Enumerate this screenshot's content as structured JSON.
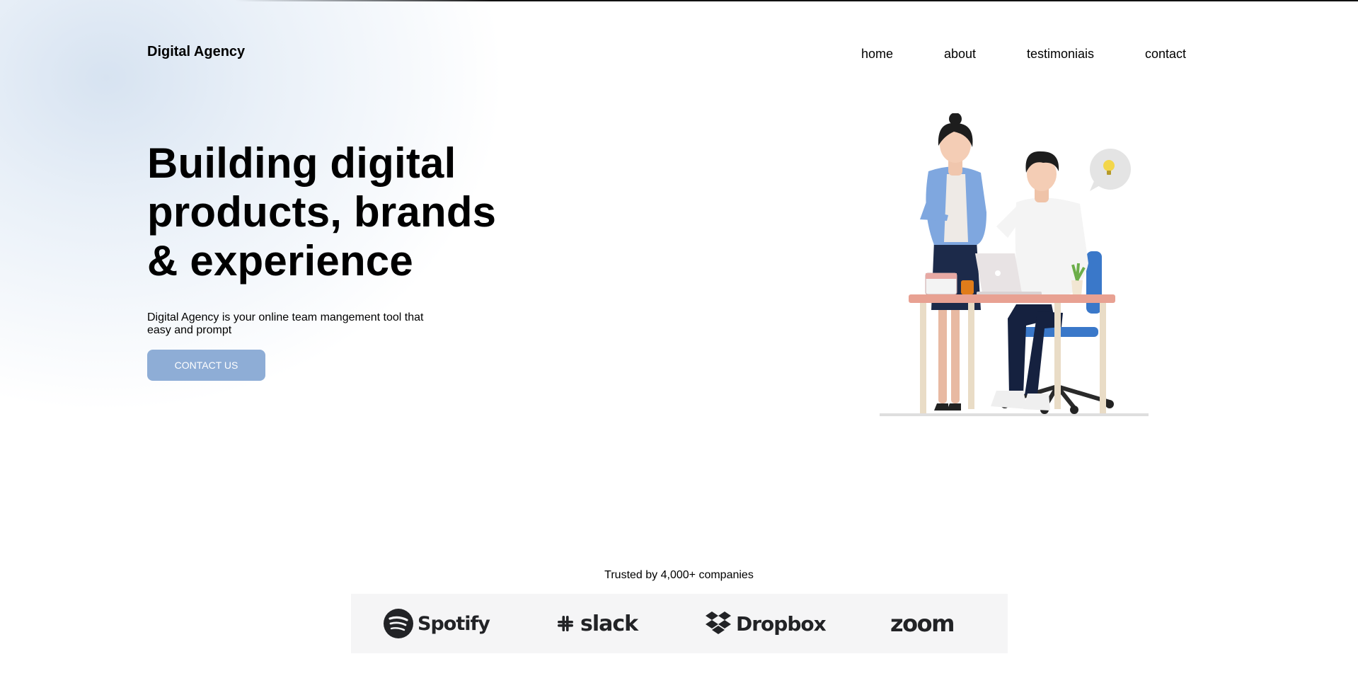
{
  "header": {
    "logo": "Digital Agency",
    "nav": [
      {
        "label": "home"
      },
      {
        "label": "about"
      },
      {
        "label": "testimoniais"
      },
      {
        "label": "contact"
      }
    ]
  },
  "hero": {
    "title_line1": "Building digital",
    "title_line2": "products, brands",
    "title_line3": "& experience",
    "description": "Digital Agency is your online team mangement tool that easy and prompt",
    "cta_label": "CONTACT US"
  },
  "trusted": {
    "label": "Trusted by 4,000+ companies",
    "logos": [
      {
        "name": "Spotify",
        "icon": "spotify-icon"
      },
      {
        "name": "slack",
        "icon": "slack-icon"
      },
      {
        "name": "Dropbox",
        "icon": "dropbox-icon"
      },
      {
        "name": "zoom",
        "icon": "zoom-wordmark"
      }
    ]
  },
  "colors": {
    "cta_background": "#8eadd6",
    "logo_strip_background": "#f5f5f6",
    "brand_logo_color": "#222326",
    "chair_blue": "#3a78c9"
  }
}
